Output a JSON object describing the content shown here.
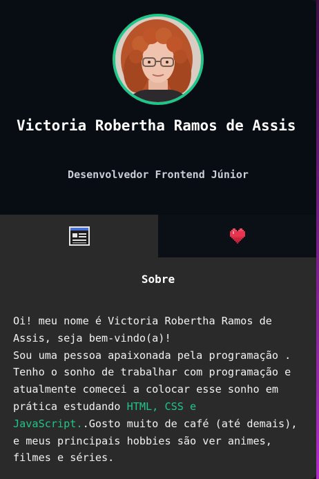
{
  "profile": {
    "name": "Victoria Robertha Ramos de Assis",
    "role": "Desenvolvedor Frontend Júnior",
    "avatar_alt": "Victoria Robertha Ramos de Assis",
    "accent_color": "#1fc689"
  },
  "tabs": [
    {
      "id": "about",
      "icon": "browser-window-icon",
      "active": true
    },
    {
      "id": "hobbies",
      "icon": "pixel-heart-icon",
      "active": false
    }
  ],
  "about": {
    "title": "Sobre",
    "text_1": "Oi! meu nome é Victoria Robertha Ramos de Assis, seja bem-vindo(a)!\nSou uma pessoa apaixonada pela programação . Tenho o sonho de trabalhar com programação e atualmente comecei a colocar esse sonho em prática estudando ",
    "highlight": "HTML, CSS e JavaScript.",
    "text_2": ".Gosto muito de café (até demais), e meus principais hobbies são ver animes, filmes e séries."
  }
}
